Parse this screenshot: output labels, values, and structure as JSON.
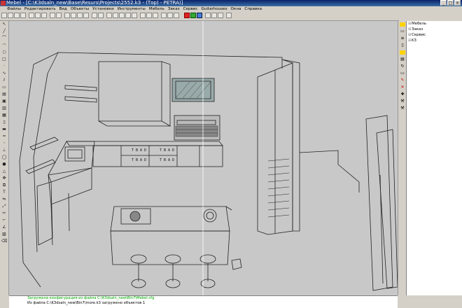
{
  "window": {
    "title": "Mebel - [C:\\K3dsaln_new\\Base\\Resurs\\Projects\\2552.k3 - (Тор) - PETRA)]",
    "minimize": "_",
    "maximize": "□",
    "close": "×"
  },
  "menu": [
    "Файлы",
    "Редактировать",
    "Вид",
    "Объекты",
    "Установки",
    "Инструменты",
    "Мебель",
    "Заказ",
    "Сервис",
    "Guitarhouses",
    "Окна",
    "Справка"
  ],
  "right_panel": {
    "items": [
      "Мебель",
      "Заказ",
      "Сервис",
      "K3"
    ]
  },
  "canvas": {
    "labels": [
      "T B A  D",
      "T B A  D",
      "T B A  D",
      "T B A  D"
    ]
  },
  "status": {
    "line1": "Загружена конфигурация из файла C:\\K3dsaln_new\\Bin7\\Mebel.cfg",
    "line2": "Из файла C:\\K3dsaln_new\\Bin7\\more.k3 загружено объектов 1"
  },
  "colors": {
    "title_bar": "#0a246a",
    "canvas_bg": "#c8c8c8",
    "wire": "#222222"
  }
}
